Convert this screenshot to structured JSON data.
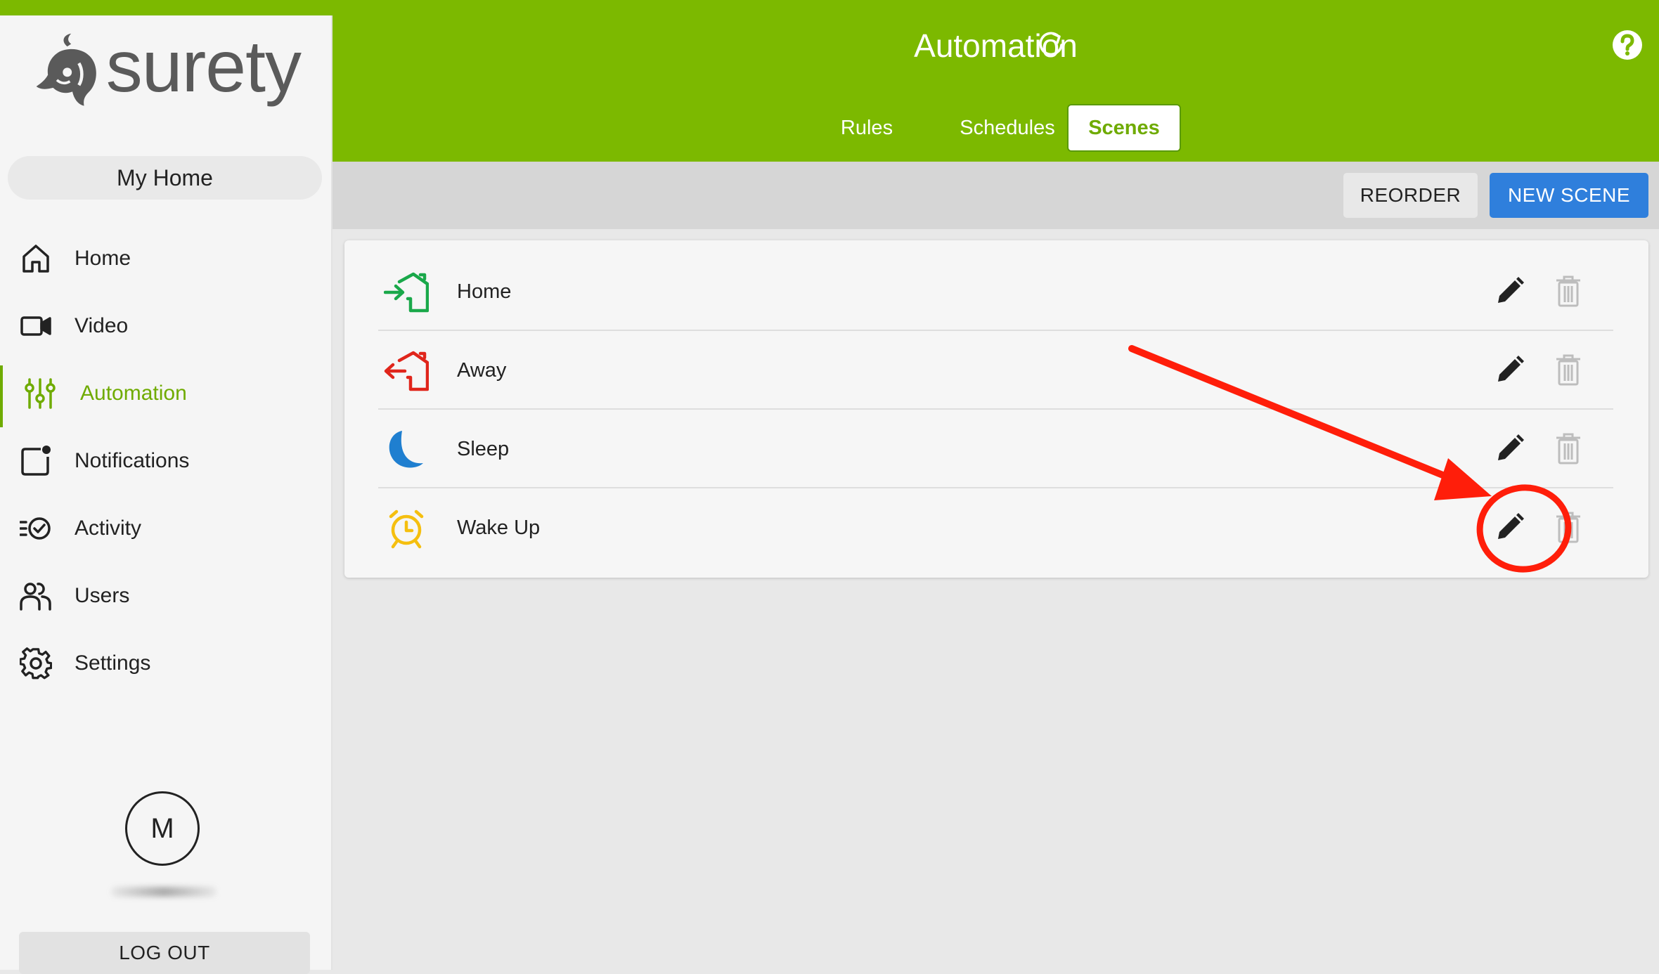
{
  "brand": {
    "logo_text": "surety",
    "accent": "#7cb900",
    "primary_button": "#2f7fdc",
    "annotation": "#ff1e0a"
  },
  "sidebar": {
    "home_selector": "My Home",
    "items": [
      {
        "label": "Home",
        "icon": "home-icon"
      },
      {
        "label": "Video",
        "icon": "video-camera-icon"
      },
      {
        "label": "Automation",
        "icon": "sliders-icon",
        "active": true
      },
      {
        "label": "Notifications",
        "icon": "notification-icon"
      },
      {
        "label": "Activity",
        "icon": "activity-icon"
      },
      {
        "label": "Users",
        "icon": "users-icon"
      },
      {
        "label": "Settings",
        "icon": "gear-icon"
      }
    ],
    "avatar_initial": "M",
    "logout_label": "LOG OUT"
  },
  "header": {
    "title": "Automation",
    "tabs": [
      {
        "label": "Rules"
      },
      {
        "label": "Schedules"
      },
      {
        "label": "Scenes",
        "active": true
      }
    ]
  },
  "toolbar": {
    "reorder_label": "REORDER",
    "new_scene_label": "NEW SCENE"
  },
  "scenes": [
    {
      "name": "Home",
      "icon": "arrive-home-icon",
      "color": "#1aa84a"
    },
    {
      "name": "Away",
      "icon": "leave-home-icon",
      "color": "#e0251b"
    },
    {
      "name": "Sleep",
      "icon": "moon-icon",
      "color": "#1f7fd0"
    },
    {
      "name": "Wake Up",
      "icon": "alarm-clock-icon",
      "color": "#f5bf0f"
    }
  ]
}
